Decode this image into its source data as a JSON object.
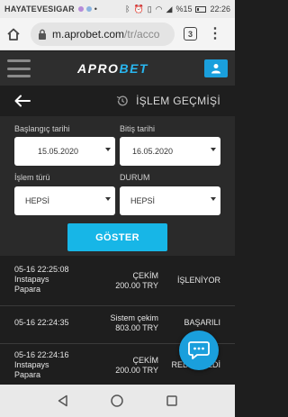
{
  "status_bar": {
    "carrier": "HAYATEVESIGAR",
    "battery": "%15",
    "time": "22:26"
  },
  "browser": {
    "url_domain": "m.aprobet.com",
    "url_path": "/tr/acco",
    "tab_count": "3"
  },
  "site": {
    "logo_part1": "APRO",
    "logo_part2": "BET"
  },
  "page": {
    "title": "İŞLEM GEÇMİŞİ"
  },
  "filters": {
    "start_label": "Başlangıç tarihi",
    "start_value": "15.05.2020",
    "end_label": "Bitiş tarihi",
    "end_value": "16.05.2020",
    "type_label": "İşlem türü",
    "type_value": "HEPSİ",
    "status_label": "DURUM",
    "status_value": "HEPSİ",
    "show_button": "GÖSTER"
  },
  "transactions": [
    {
      "datetime": "05-16 22:25:08",
      "provider_line1": "Instapays",
      "provider_line2": "Papara",
      "type": "ÇEKİM",
      "amount": "200.00 TRY",
      "status": "İŞLENİYOR"
    },
    {
      "datetime": "05-16 22:24:35",
      "provider_line1": "",
      "provider_line2": "",
      "type": "Sistem çekim",
      "amount": "803.00 TRY",
      "status": "BAŞARILI"
    },
    {
      "datetime": "05-16 22:24:16",
      "provider_line1": "Instapays",
      "provider_line2": "Papara",
      "type": "ÇEKİM",
      "amount": "200.00 TRY",
      "status": "REDDEDİLDİ"
    }
  ],
  "colors": {
    "accent": "#1a9fdc",
    "button": "#17b6e7",
    "background": "#1e1e1e",
    "header": "#2e2e2e"
  }
}
